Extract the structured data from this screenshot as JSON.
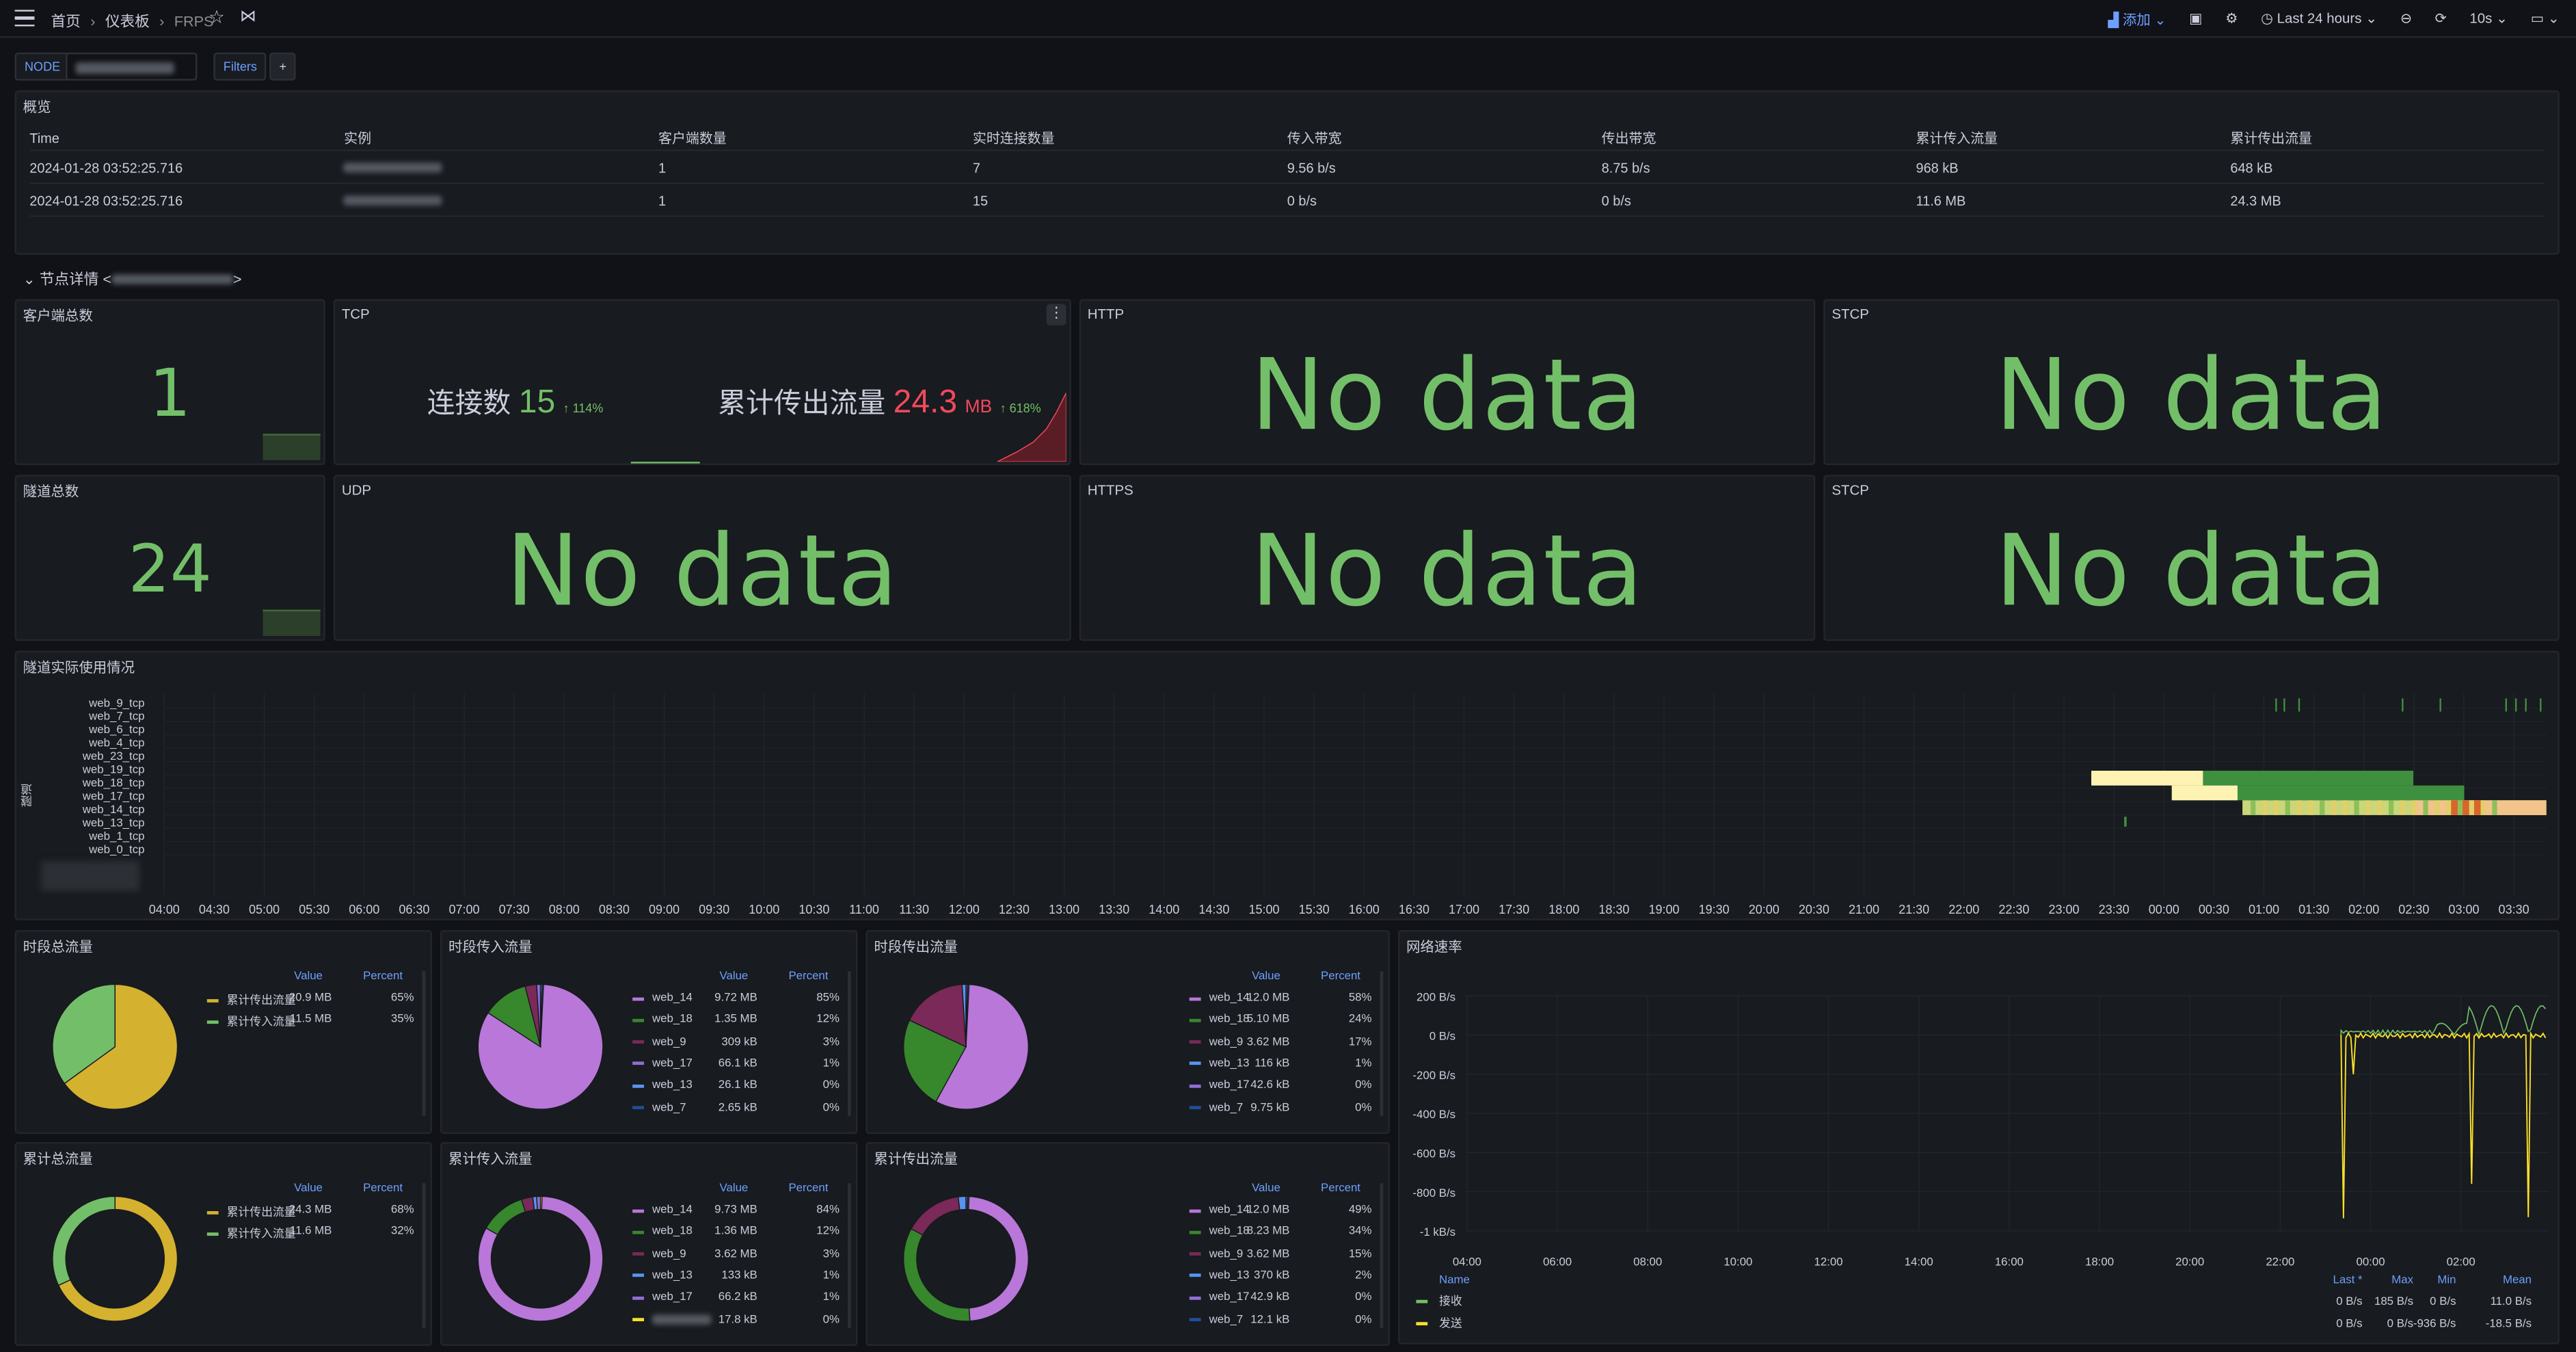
{
  "breadcrumb": {
    "home": "首页",
    "dashboards": "仪表板",
    "current": "FRPS"
  },
  "toolbar": {
    "add": "添加",
    "time_range": "Last 24 hours",
    "refresh": "10s"
  },
  "filters": {
    "node_label": "NODE",
    "filters_label": "Filters",
    "add": "+"
  },
  "overview": {
    "title": "概览",
    "columns": [
      "Time",
      "实例",
      "客户端数量",
      "实时连接数量",
      "传入带宽",
      "传出带宽",
      "累计传入流量",
      "累计传出流量"
    ],
    "rows": [
      [
        "2024-01-28 03:52:25.716",
        "",
        "1",
        "7",
        "9.56 b/s",
        "8.75 b/s",
        "968 kB",
        "648 kB"
      ],
      [
        "2024-01-28 03:52:25.716",
        "",
        "1",
        "15",
        "0 b/s",
        "0 b/s",
        "11.6 MB",
        "24.3 MB"
      ]
    ]
  },
  "row_header": {
    "title": "节点详情 <",
    "suffix": ">"
  },
  "stats": {
    "clients": {
      "title": "客户端总数",
      "value": "1"
    },
    "tunnels": {
      "title": "隧道总数",
      "value": "24"
    },
    "tcp": {
      "title": "TCP",
      "conn_label": "连接数",
      "conn_value": "15",
      "conn_delta": "114%",
      "out_label": "累计传出流量",
      "out_value": "24.3",
      "out_unit": "MB",
      "out_delta": "618%"
    },
    "http": {
      "title": "HTTP",
      "value": "No data"
    },
    "stcp1": {
      "title": "STCP",
      "value": "No data"
    },
    "udp": {
      "title": "UDP",
      "value": "No data"
    },
    "https": {
      "title": "HTTPS",
      "value": "No data"
    },
    "stcp2": {
      "title": "STCP",
      "value": "No data"
    }
  },
  "heatmap": {
    "title": "隧道实际使用情况",
    "ylabel": "隧道",
    "rows": [
      "web_9_tcp",
      "web_7_tcp",
      "web_6_tcp",
      "web_4_tcp",
      "web_23_tcp",
      "web_19_tcp",
      "web_18_tcp",
      "web_17_tcp",
      "web_14_tcp",
      "web_13_tcp",
      "web_1_tcp",
      "web_0_tcp"
    ],
    "xticks": [
      "04:00",
      "04:30",
      "05:00",
      "05:30",
      "06:00",
      "06:30",
      "07:00",
      "07:30",
      "08:00",
      "08:30",
      "09:00",
      "09:30",
      "10:00",
      "10:30",
      "11:00",
      "11:30",
      "12:00",
      "12:30",
      "13:00",
      "13:30",
      "14:00",
      "14:30",
      "15:00",
      "15:30",
      "16:00",
      "16:30",
      "17:00",
      "17:30",
      "18:00",
      "18:30",
      "19:00",
      "19:30",
      "20:00",
      "20:30",
      "21:00",
      "21:30",
      "22:00",
      "22:30",
      "23:00",
      "23:30",
      "00:00",
      "00:30",
      "01:00",
      "01:30",
      "02:00",
      "02:30",
      "03:00",
      "03:30"
    ]
  },
  "pies": {
    "period_total": {
      "title": "时段总流量",
      "header": [
        "Value",
        "Percent"
      ],
      "items": [
        {
          "name": "累计传出流量",
          "value": "20.9 MB",
          "percent": "65%",
          "color": "#d4b12f"
        },
        {
          "name": "累计传入流量",
          "value": "11.5 MB",
          "percent": "35%",
          "color": "#73bf69"
        }
      ]
    },
    "period_in": {
      "title": "时段传入流量",
      "header": [
        "Value",
        "Percent"
      ],
      "items": [
        {
          "name": "web_14",
          "value": "9.72 MB",
          "percent": "85%",
          "color": "#b877d9"
        },
        {
          "name": "web_18",
          "value": "1.35 MB",
          "percent": "12%",
          "color": "#37872d"
        },
        {
          "name": "web_9",
          "value": "309 kB",
          "percent": "3%",
          "color": "#7a2958"
        },
        {
          "name": "web_17",
          "value": "66.1 kB",
          "percent": "1%",
          "color": "#8f6ed5"
        },
        {
          "name": "web_13",
          "value": "26.1 kB",
          "percent": "0%",
          "color": "#5794f2"
        },
        {
          "name": "web_7",
          "value": "2.65 kB",
          "percent": "0%",
          "color": "#1f4e99"
        }
      ]
    },
    "period_out": {
      "title": "时段传出流量",
      "header": [
        "Value",
        "Percent"
      ],
      "items": [
        {
          "name": "web_14",
          "value": "12.0 MB",
          "percent": "58%",
          "color": "#b877d9"
        },
        {
          "name": "web_18",
          "value": "5.10 MB",
          "percent": "24%",
          "color": "#37872d"
        },
        {
          "name": "web_9",
          "value": "3.62 MB",
          "percent": "17%",
          "color": "#7a2958"
        },
        {
          "name": "web_13",
          "value": "116 kB",
          "percent": "1%",
          "color": "#5794f2"
        },
        {
          "name": "web_17",
          "value": "42.6 kB",
          "percent": "0%",
          "color": "#8f6ed5"
        },
        {
          "name": "web_7",
          "value": "9.75 kB",
          "percent": "0%",
          "color": "#1f4e99"
        }
      ]
    },
    "cum_total": {
      "title": "累计总流量",
      "header": [
        "Value",
        "Percent"
      ],
      "items": [
        {
          "name": "累计传出流量",
          "value": "24.3 MB",
          "percent": "68%",
          "color": "#d4b12f"
        },
        {
          "name": "累计传入流量",
          "value": "11.6 MB",
          "percent": "32%",
          "color": "#73bf69"
        }
      ]
    },
    "cum_in": {
      "title": "累计传入流量",
      "header": [
        "Value",
        "Percent"
      ],
      "items": [
        {
          "name": "web_14",
          "value": "9.73 MB",
          "percent": "84%",
          "color": "#b877d9"
        },
        {
          "name": "web_18",
          "value": "1.36 MB",
          "percent": "12%",
          "color": "#37872d"
        },
        {
          "name": "web_9",
          "value": "3.62 MB",
          "percent": "3%",
          "color": "#7a2958"
        },
        {
          "name": "web_13",
          "value": "133 kB",
          "percent": "1%",
          "color": "#5794f2"
        },
        {
          "name": "web_17",
          "value": "66.2 kB",
          "percent": "1%",
          "color": "#8f6ed5"
        },
        {
          "name": "",
          "value": "17.8 kB",
          "percent": "0%",
          "color": "#fade2a"
        }
      ]
    },
    "cum_out": {
      "title": "累计传出流量",
      "header": [
        "Value",
        "Percent"
      ],
      "items": [
        {
          "name": "web_14",
          "value": "12.0 MB",
          "percent": "49%",
          "color": "#b877d9"
        },
        {
          "name": "web_18",
          "value": "8.23 MB",
          "percent": "34%",
          "color": "#37872d"
        },
        {
          "name": "web_9",
          "value": "3.62 MB",
          "percent": "15%",
          "color": "#7a2958"
        },
        {
          "name": "web_13",
          "value": "370 kB",
          "percent": "2%",
          "color": "#5794f2"
        },
        {
          "name": "web_17",
          "value": "42.9 kB",
          "percent": "0%",
          "color": "#8f6ed5"
        },
        {
          "name": "web_7",
          "value": "12.1 kB",
          "percent": "0%",
          "color": "#1f4e99"
        }
      ]
    }
  },
  "network": {
    "title": "网络速率",
    "yticks": [
      "200 B/s",
      "0 B/s",
      "-200 B/s",
      "-400 B/s",
      "-600 B/s",
      "-800 B/s",
      "-1 kB/s"
    ],
    "xticks": [
      "04:00",
      "06:00",
      "08:00",
      "10:00",
      "12:00",
      "14:00",
      "16:00",
      "18:00",
      "20:00",
      "22:00",
      "00:00",
      "02:00"
    ],
    "legend_header": [
      "Name",
      "Last *",
      "Max",
      "Min",
      "Mean"
    ],
    "legend": [
      {
        "name": "接收",
        "last": "0 B/s",
        "max": "185 B/s",
        "min": "0 B/s",
        "mean": "11.0 B/s",
        "color": "#73bf69"
      },
      {
        "name": "发送",
        "last": "0 B/s",
        "max": "0 B/s",
        "min": "-936 B/s",
        "mean": "-18.5 B/s",
        "color": "#fade2a"
      }
    ]
  },
  "chart_data": [
    {
      "type": "pie",
      "title": "时段总流量",
      "categories": [
        "累计传出流量",
        "累计传入流量"
      ],
      "values": [
        65,
        35
      ]
    },
    {
      "type": "pie",
      "title": "时段传入流量",
      "categories": [
        "web_14",
        "web_18",
        "web_9",
        "web_17",
        "web_13",
        "web_7"
      ],
      "values": [
        85,
        12,
        3,
        1,
        0,
        0
      ]
    },
    {
      "type": "pie",
      "title": "时段传出流量",
      "categories": [
        "web_14",
        "web_18",
        "web_9",
        "web_13",
        "web_17",
        "web_7"
      ],
      "values": [
        58,
        24,
        17,
        1,
        0,
        0
      ]
    },
    {
      "type": "pie",
      "title": "累计总流量",
      "categories": [
        "累计传出流量",
        "累计传入流量"
      ],
      "values": [
        68,
        32
      ]
    },
    {
      "type": "pie",
      "title": "累计传入流量",
      "categories": [
        "web_14",
        "web_18",
        "web_9",
        "web_13",
        "web_17",
        ""
      ],
      "values": [
        84,
        12,
        3,
        1,
        1,
        0
      ]
    },
    {
      "type": "pie",
      "title": "累计传出流量",
      "categories": [
        "web_14",
        "web_18",
        "web_9",
        "web_13",
        "web_17",
        "web_7"
      ],
      "values": [
        49,
        34,
        15,
        2,
        0,
        0
      ]
    },
    {
      "type": "line",
      "title": "网络速率",
      "ylim": [
        -1000,
        200
      ],
      "series": [
        {
          "name": "接收",
          "max": 185,
          "min": 0,
          "mean": 11.0
        },
        {
          "name": "发送",
          "max": 0,
          "min": -936,
          "mean": -18.5
        }
      ]
    }
  ]
}
